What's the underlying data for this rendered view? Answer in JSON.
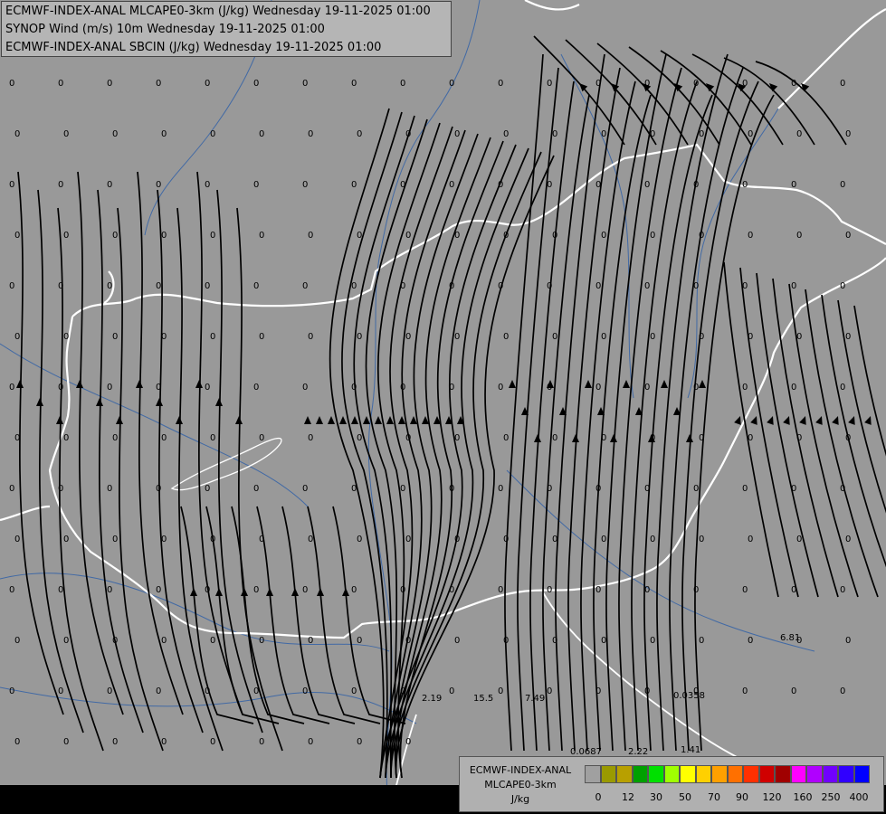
{
  "header": {
    "line1": "ECMWF-INDEX-ANAL MLCAPE0-3km (J/kg) Wednesday 19-11-2025 01:00",
    "line2": "SYNOP Wind (m/s) 10m Wednesday 19-11-2025 01:00",
    "line3": "ECMWF-INDEX-ANAL SBCIN (J/kg) Wednesday 19-11-2025 01:00"
  },
  "legend": {
    "title": "ECMWF-INDEX-ANAL",
    "param": "MLCAPE0-3km",
    "unit": "J/kg",
    "ticks": [
      "0",
      "12",
      "30",
      "50",
      "70",
      "90",
      "120",
      "160",
      "250",
      "400"
    ],
    "colors": [
      "#a0a0a0",
      "#9a9a00",
      "#b8a000",
      "#00a000",
      "#00e000",
      "#a0ff00",
      "#ffff00",
      "#ffd000",
      "#ffa000",
      "#ff7000",
      "#ff3000",
      "#d00000",
      "#a00000",
      "#ff00ff",
      "#b000ff",
      "#7000ff",
      "#3000ff",
      "#0000ff",
      "#0080ff",
      "#00c0ff",
      "#00ffff",
      "#80ffff",
      "#ffffff"
    ]
  },
  "values": {
    "labels": [
      "0",
      "6.81",
      "0.0358",
      "2.19",
      "15.5",
      "7.49",
      "0.0687",
      "2.22",
      "1.41"
    ]
  }
}
